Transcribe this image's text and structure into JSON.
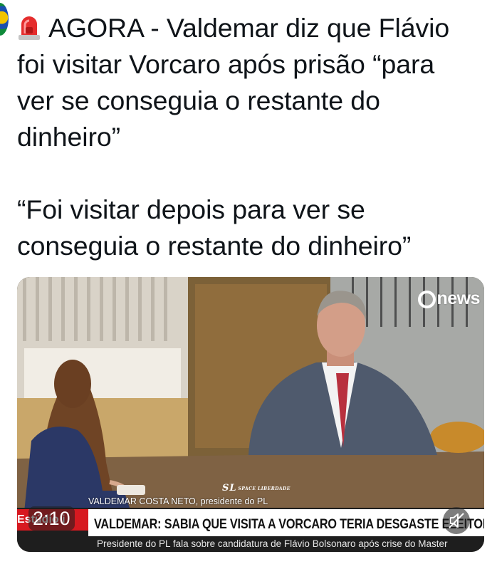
{
  "tweet": {
    "text": "AGORA - Valdemar diz que Flávio\nfoi visitar Vorcaro após prisão “para\nver se conseguia o restante do\ndinheiro”\n\n“Foi visitar depois para ver se\nconseguia o restante do dinheiro”",
    "emoji": "siren-icon"
  },
  "video": {
    "channel_logo": "news",
    "studio_stamp": "SL",
    "studio_stamp_small": "SPACE LIBERDADE",
    "name_strip": "VALDEMAR COSTA NETO, presidente do PL",
    "section_tag": "Estúdio i",
    "headline": "VALDEMAR: SABIA QUE VISITA A VORCARO TERIA DESGASTE ELEITORAL",
    "subheadline": "Presidente do PL fala sobre candidatura de Flávio Bolsonaro após crise do Master",
    "duration": "2:10",
    "muted": true,
    "colors": {
      "accent": "#d71920",
      "lower_third": "#1e1e1e"
    }
  }
}
